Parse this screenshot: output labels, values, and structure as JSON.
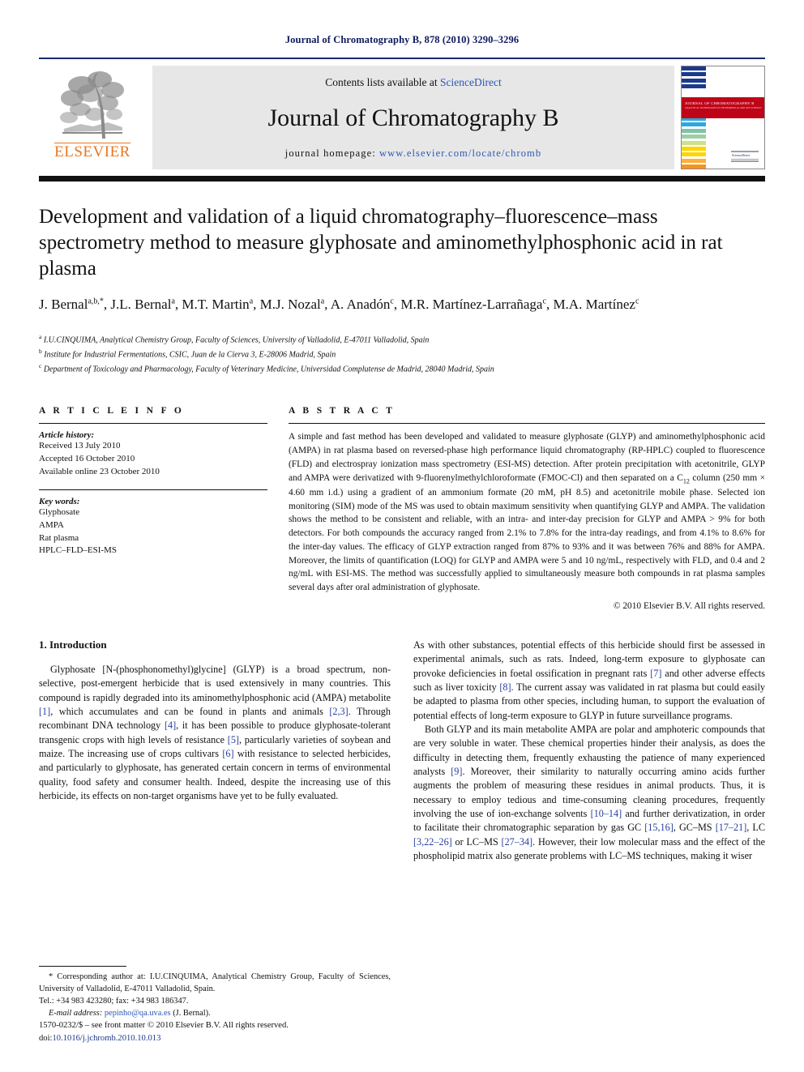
{
  "running_head": "Journal of Chromatography B, 878 (2010) 3290–3296",
  "masthead": {
    "contents_prefix": "Contents lists available at ",
    "sciencedirect": "ScienceDirect",
    "journal_title": "Journal of Chromatography B",
    "homepage_prefix": "journal homepage: ",
    "homepage_url": "www.elsevier.com/locate/chromb",
    "publisher_wordmark": "ELSEVIER",
    "cover_title": "JOURNAL OF CHROMATOGRAPHY B",
    "cover_subtitle": "ANALYTICAL TECHNOLOGIES IN THE BIOMEDICAL AND LIFE SCIENCES",
    "cover_logo_word": "ScienceDirect",
    "colors": {
      "rule_blue": "#1a2a6c",
      "band_gray": "#e7e7e8",
      "link_blue": "#2a56b5",
      "elsevier_orange": "#E87722",
      "cover_red": "#c00418"
    }
  },
  "article": {
    "title": "Development and validation of a liquid chromatography–fluorescence–mass spectrometry method to measure glyphosate and aminomethylphosphonic acid in rat plasma",
    "authors": "J. Bernal a,b,*, J.L. Bernal a, M.T. Martin a, M.J. Nozal a, A. Anadón c, M.R. Martínez-Larrañaga c, M.A. Martínez c",
    "author_list": [
      {
        "name": "J. Bernal",
        "marks": "a,b,*"
      },
      {
        "name": "J.L. Bernal",
        "marks": "a"
      },
      {
        "name": "M.T. Martin",
        "marks": "a"
      },
      {
        "name": "M.J. Nozal",
        "marks": "a"
      },
      {
        "name": "A. Anadón",
        "marks": "c"
      },
      {
        "name": "M.R. Martínez-Larrañaga",
        "marks": "c"
      },
      {
        "name": "M.A. Martínez",
        "marks": "c"
      }
    ],
    "affiliations": [
      {
        "mark": "a",
        "text": "I.U.CINQUIMA, Analytical Chemistry Group, Faculty of Sciences, University of Valladolid, E-47011 Valladolid, Spain"
      },
      {
        "mark": "b",
        "text": "Institute for Industrial Fermentations, CSIC, Juan de la Cierva 3, E-28006 Madrid, Spain"
      },
      {
        "mark": "c",
        "text": "Department of Toxicology and Pharmacology, Faculty of Veterinary Medicine, Universidad Complutense de Madrid, 28040 Madrid, Spain"
      }
    ]
  },
  "article_info": {
    "heading": "A R T I C L E   I N F O",
    "history_label": "Article history:",
    "history": [
      "Received 13 July 2010",
      "Accepted 16 October 2010",
      "Available online 23 October 2010"
    ],
    "keywords_label": "Key words:",
    "keywords": [
      "Glyphosate",
      "AMPA",
      "Rat plasma",
      "HPLC–FLD–ESI-MS"
    ]
  },
  "abstract": {
    "heading": "A B S T R A C T",
    "part1": "A simple and fast method has been developed and validated to measure glyphosate (GLYP) and aminomethylphosphonic acid (AMPA) in rat plasma based on reversed-phase high performance liquid chromatography (RP-HPLC) coupled to fluorescence (FLD) and electrospray ionization mass spectrometry (ESI-MS) detection. After protein precipitation with acetonitrile, GLYP and AMPA were derivatized with 9-fluorenylmethylchloroformate (FMOC-Cl) and then separated on a C",
    "sub1": "12",
    "part2": " column (250 mm × 4.60 mm i.d.) using a gradient of an ammonium formate (20 mM, pH 8.5) and acetonitrile mobile phase. Selected ion monitoring (SIM) mode of the MS was used to obtain maximum sensitivity when quantifying GLYP and AMPA. The validation shows the method to be consistent and reliable, with an intra- and inter-day precision for GLYP and AMPA > 9% for both detectors. For both compounds the accuracy ranged from 2.1% to 7.8% for the intra-day readings, and from 4.1% to 8.6% for the inter-day values. The efficacy of GLYP extraction ranged from 87% to 93% and it was between 76% and 88% for AMPA. Moreover, the limits of quantification (LOQ) for GLYP and AMPA were 5 and 10 ng/mL, respectively with FLD, and 0.4 and 2 ng/mL with ESI-MS. The method was successfully applied to simultaneously measure both compounds in rat plasma samples several days after oral administration of glyphosate.",
    "copyright": "© 2010 Elsevier B.V. All rights reserved."
  },
  "introduction": {
    "section_number_title": "1.  Introduction",
    "left_paragraph_1": [
      {
        "t": "Glyphosate [N-(phosphonomethyl)glycine] (GLYP) is a broad spectrum, non-selective, post-emergent herbicide that is used extensively in many countries. This compound is rapidly degraded into its aminomethylphosphonic acid (AMPA) metabolite "
      },
      {
        "t": "[1]",
        "ref": true
      },
      {
        "t": ", which accumulates and can be found in plants and animals "
      },
      {
        "t": "[2,3]",
        "ref": true
      },
      {
        "t": ". Through recombinant DNA technology "
      },
      {
        "t": "[4]",
        "ref": true
      },
      {
        "t": ", it has been possible to produce glyphosate-tolerant transgenic crops with high levels of resistance "
      },
      {
        "t": "[5]",
        "ref": true
      },
      {
        "t": ", particularly varieties of soybean and maize. The increasing use of crops cultivars "
      },
      {
        "t": "[6]",
        "ref": true
      },
      {
        "t": " with resistance to selected herbicides, and particularly to glyphosate, has generated certain concern in terms of environmental quality, food safety and consumer health. Indeed, despite the increasing use of this herbicide, its effects on non-target organisms have yet to be fully evaluated."
      }
    ],
    "right_paragraph_1": [
      {
        "t": "As with other substances, potential effects of this herbicide should first be assessed in experimental animals, such as rats. Indeed, long-term exposure to glyphosate can provoke deficiencies in foetal ossification in pregnant rats "
      },
      {
        "t": "[7]",
        "ref": true
      },
      {
        "t": " and other adverse effects such as liver toxicity "
      },
      {
        "t": "[8]",
        "ref": true
      },
      {
        "t": ". The current assay was validated in rat plasma but could easily be adapted to plasma from other species, including human, to support the evaluation of potential effects of long-term exposure to GLYP in future surveillance programs."
      }
    ],
    "right_paragraph_2": [
      {
        "t": "Both GLYP and its main metabolite AMPA are polar and amphoteric compounds that are very soluble in water. These chemical properties hinder their analysis, as does the difficulty in detecting them, frequently exhausting the patience of many experienced analysts "
      },
      {
        "t": "[9]",
        "ref": true
      },
      {
        "t": ". Moreover, their similarity to naturally occurring amino acids further augments the problem of measuring these residues in animal products. Thus, it is necessary to employ tedious and time-consuming cleaning procedures, frequently involving the use of ion-exchange solvents "
      },
      {
        "t": "[10–14]",
        "ref": true
      },
      {
        "t": " and further derivatization, in order to facilitate their chromatographic separation by gas GC "
      },
      {
        "t": "[15,16]",
        "ref": true
      },
      {
        "t": ", GC–MS "
      },
      {
        "t": "[17–21]",
        "ref": true
      },
      {
        "t": ", LC "
      },
      {
        "t": "[3,22–26]",
        "ref": true
      },
      {
        "t": " or LC–MS "
      },
      {
        "t": "[27–34]",
        "ref": true
      },
      {
        "t": ". However, their low molecular mass and the effect of the phospholipid matrix also generate problems with LC–MS techniques, making it wiser"
      }
    ]
  },
  "footnote": {
    "corresponding": "* Corresponding author at: I.U.CINQUIMA, Analytical Chemistry Group, Faculty of Sciences, University of Valladolid, E-47011 Valladolid, Spain.",
    "tel": "Tel.: +34 983 423280; fax: +34 983 186347.",
    "email_label": "E-mail address:",
    "email": "pepinho@qa.uva.es",
    "email_owner": "(J. Bernal)."
  },
  "footer": {
    "issn_line": "1570-0232/$ – see front matter © 2010 Elsevier B.V. All rights reserved.",
    "doi_prefix": "doi:",
    "doi": "10.1016/j.jchromb.2010.10.013"
  }
}
